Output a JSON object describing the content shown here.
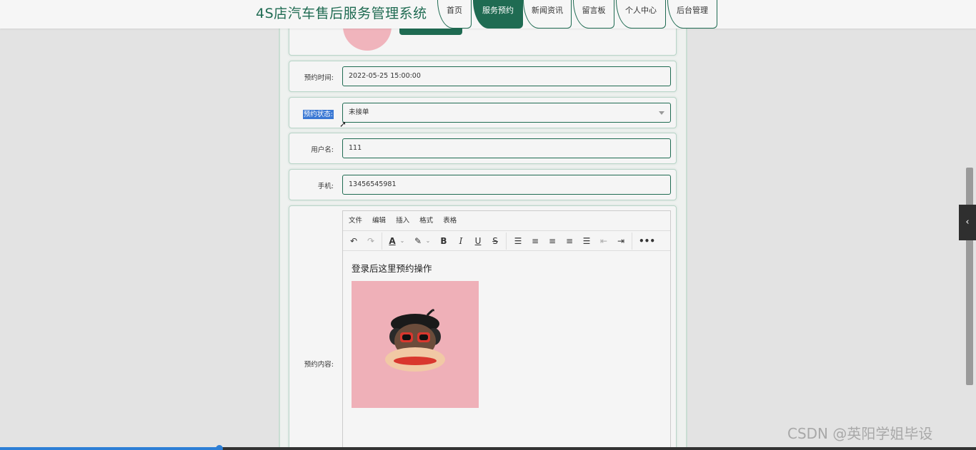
{
  "header": {
    "site_title": "4S店汽车售后服务管理系统",
    "nav": [
      {
        "label": "首页",
        "active": false
      },
      {
        "label": "服务预约",
        "active": true
      },
      {
        "label": "新闻资讯",
        "active": false
      },
      {
        "label": "留言板",
        "active": false
      },
      {
        "label": "个人中心",
        "active": false
      },
      {
        "label": "后台管理",
        "active": false
      }
    ]
  },
  "form": {
    "time_label": "预约时间:",
    "time_value": "2022-05-25 15:00:00",
    "status_label": "预约状态:",
    "status_value": "未接单",
    "username_label": "用户名:",
    "username_value": "111",
    "phone_label": "手机:",
    "phone_value": "13456545981",
    "content_label": "预约内容:"
  },
  "editor": {
    "menus": [
      "文件",
      "编辑",
      "插入",
      "格式",
      "表格"
    ],
    "content_text": "登录后这里预约操作"
  },
  "colors": {
    "accent": "#1f6b52",
    "selection": "#3a78d4"
  },
  "playback": {
    "progress_fraction": 0.225
  },
  "watermark": "CSDN @英阳学姐毕设"
}
